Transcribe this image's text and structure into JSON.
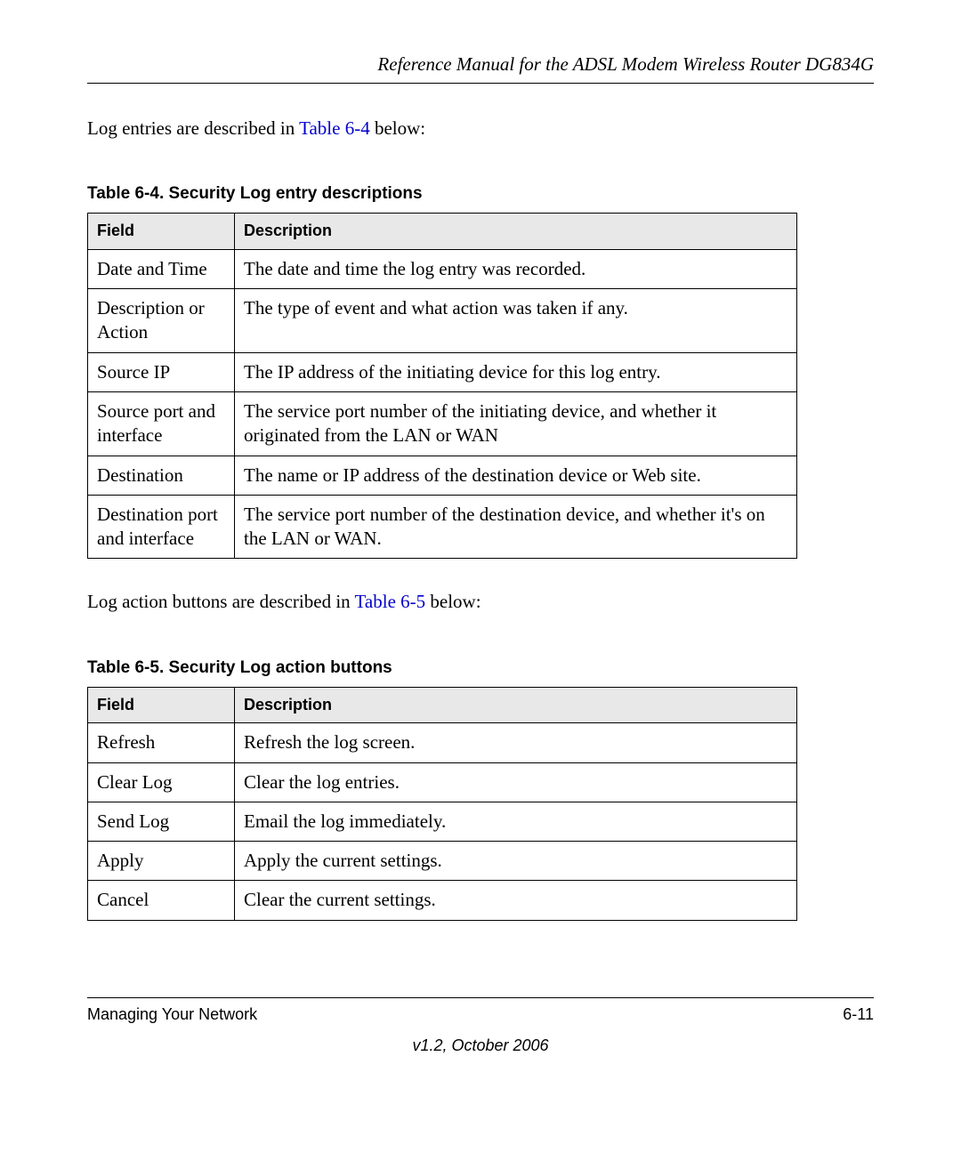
{
  "header": {
    "title": "Reference Manual for the ADSL Modem Wireless Router DG834G"
  },
  "body": {
    "para1_prefix": "Log entries are described in ",
    "para1_link": "Table 6-4",
    "para1_suffix": " below:",
    "table1_caption": "Table 6-4. Security Log entry descriptions",
    "table1_headers": {
      "field": "Field",
      "description": "Description"
    },
    "table1_rows": [
      {
        "field": "Date and Time",
        "description": "The date and time the log entry was recorded."
      },
      {
        "field": "Description or Action",
        "description": "The type of event and what action was taken if any."
      },
      {
        "field": "Source IP",
        "description": "The IP address of the initiating device for this log entry."
      },
      {
        "field": "Source port and interface",
        "description": "The service port number of the initiating device, and whether it originated from the LAN or WAN"
      },
      {
        "field": "Destination",
        "description": "The name or IP address of the destination device or Web site."
      },
      {
        "field": "Destination port and interface",
        "description": "The service port number of the destination device, and whether it's on the LAN or WAN."
      }
    ],
    "para2_prefix": "Log action buttons are described in ",
    "para2_link": "Table 6-5",
    "para2_suffix": " below:",
    "table2_caption": "Table 6-5. Security Log action buttons",
    "table2_headers": {
      "field": "Field",
      "description": "Description"
    },
    "table2_rows": [
      {
        "field": "Refresh",
        "description": "Refresh the log screen."
      },
      {
        "field": "Clear Log",
        "description": "Clear the log entries."
      },
      {
        "field": "Send Log",
        "description": "Email the log immediately."
      },
      {
        "field": "Apply",
        "description": "Apply the current settings."
      },
      {
        "field": "Cancel",
        "description": "Clear the current settings."
      }
    ]
  },
  "footer": {
    "section": "Managing Your Network",
    "page": "6-11",
    "version": "v1.2, October 2006"
  }
}
